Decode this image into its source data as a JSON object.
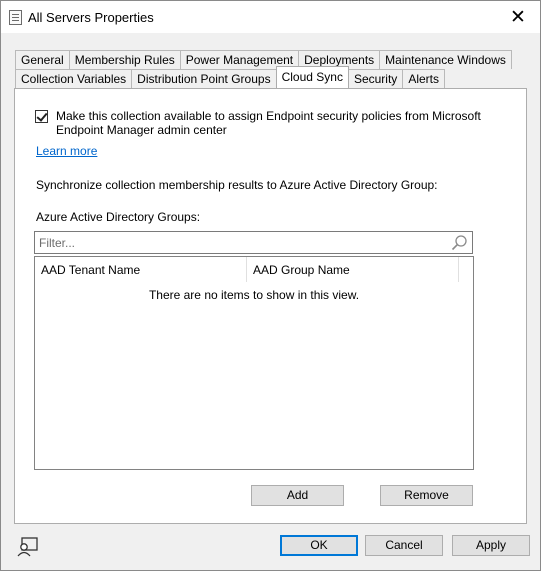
{
  "window": {
    "title": "All Servers Properties",
    "close_glyph": "✕"
  },
  "tabs": {
    "row1": [
      "General",
      "Membership Rules",
      "Power Management",
      "Deployments",
      "Maintenance Windows"
    ],
    "row2": [
      "Collection Variables",
      "Distribution Point Groups",
      "Cloud Sync",
      "Security",
      "Alerts"
    ],
    "active": "Cloud Sync"
  },
  "cloud_sync": {
    "checkbox_checked": true,
    "checkbox_label": "Make this collection available to assign Endpoint security policies from Microsoft Endpoint Manager admin center",
    "learn_more": "Learn more",
    "sync_text": "Synchronize collection membership results to Azure Active Directory Group:",
    "groups_label": "Azure Active Directory Groups:",
    "filter_placeholder": "Filter...",
    "columns": [
      "AAD Tenant Name",
      "AAD Group Name"
    ],
    "empty_text": "There are no items to show in this view.",
    "add_label": "Add",
    "remove_label": "Remove"
  },
  "footer": {
    "ok_label": "OK",
    "cancel_label": "Cancel",
    "apply_label": "Apply"
  },
  "icons": {
    "title": "properties-window-icon",
    "search": "search-icon",
    "help": "help-icon"
  }
}
